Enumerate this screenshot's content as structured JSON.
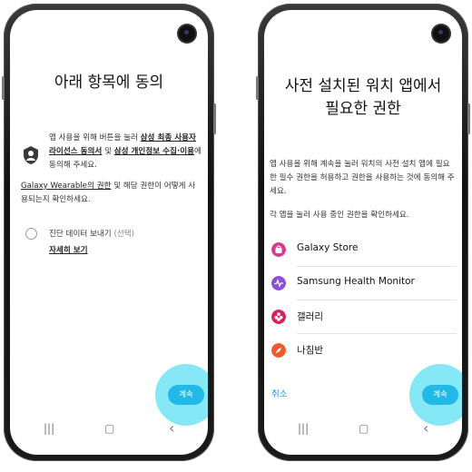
{
  "left": {
    "title_line1": "아래 항목에 동의",
    "consent_text": {
      "part1": "앱 사용을 위해 버튼을 눌러 ",
      "link1": "삼성 최종 사용자 라이선스 동의서",
      "part2": " 및 ",
      "link2": "삼성 개인정보 수집·이용",
      "part3": "에 동의해 주세요."
    },
    "permissions_text": {
      "link": "Galaxy Wearable의 권한",
      "rest": " 및 해당 권한이 어떻게 사용되는지 확인하세요."
    },
    "diagnostic": {
      "label": "진단 데이터 보내기",
      "optional": "(선택)",
      "details": "자세히 보기"
    },
    "continue_label": "계속"
  },
  "right": {
    "title_line1": "사전 설치된 워치 앱에서",
    "title_line2": "필요한 권한",
    "description": "앱 사용을 위해 계속을 눌러 워치의 사전 설치 앱에 필요한 필수 권한을 허용하고 권한을 사용하는 것에 동의해 주세요.",
    "note": "각 앱을 눌러 사용 중인 권한을 확인하세요.",
    "apps": [
      {
        "name": "Galaxy Store",
        "icon": "galaxy-store-icon",
        "color": "#d93a8c"
      },
      {
        "name": "Samsung Health Monitor",
        "icon": "health-monitor-icon",
        "color": "#8a4fd8"
      },
      {
        "name": "갤러리",
        "icon": "gallery-icon",
        "color": "#d8205a"
      },
      {
        "name": "나침반",
        "icon": "compass-icon",
        "color": "#ee5a2c"
      }
    ],
    "cancel_label": "취소",
    "continue_label": "계속"
  },
  "nav": {
    "recent": "|||",
    "home": "▢",
    "back": "‹"
  }
}
